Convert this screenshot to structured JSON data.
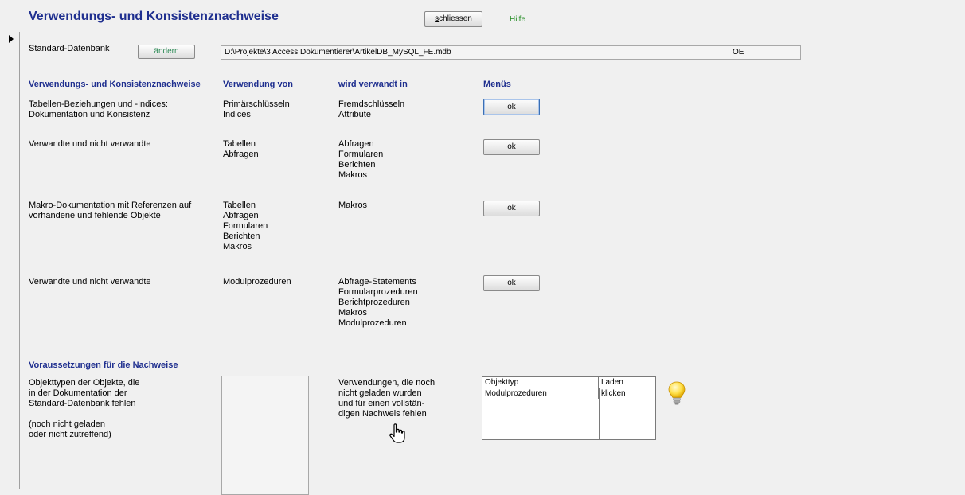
{
  "header": {
    "title": "Verwendungs- und Konsistenznachweise",
    "close_button": "schliessen",
    "close_accesskey": "s",
    "close_rest": "chliessen",
    "help": "Hilfe"
  },
  "database": {
    "label": "Standard-Datenbank",
    "change_button": "ändern",
    "path": "D:\\Projekte\\3 Access Dokumentierer\\ArtikelDB_MySQL_FE.mdb",
    "suffix": "OE"
  },
  "columns": {
    "c1": "Verwendungs- und Konsistenznachweise",
    "c2": "Verwendung von",
    "c3": "wird verwandt in",
    "c4": "Menüs"
  },
  "rows": [
    {
      "desc": [
        "Tabellen-Beziehungen und -Indices:",
        "Dokumentation und Konsistenz"
      ],
      "uses": [
        "Primärschlüsseln",
        "Indices"
      ],
      "used_in": [
        "Fremdschlüsseln",
        "Attribute"
      ],
      "button": "ok"
    },
    {
      "desc": [
        "Verwandte und nicht verwandte"
      ],
      "uses": [
        "Tabellen",
        "Abfragen"
      ],
      "used_in": [
        "Abfragen",
        "Formularen",
        "Berichten",
        "Makros"
      ],
      "button": "ok"
    },
    {
      "desc": [
        "Makro-Dokumentation mit Referenzen auf",
        "vorhandene und fehlende Objekte"
      ],
      "uses": [
        "Tabellen",
        "Abfragen",
        "Formularen",
        "Berichten",
        "Makros"
      ],
      "used_in": [
        "Makros"
      ],
      "button": "ok"
    },
    {
      "desc": [
        "Verwandte und nicht verwandte"
      ],
      "uses": [
        "Modulprozeduren"
      ],
      "used_in": [
        "Abfrage-Statements",
        "Formularprozeduren",
        "Berichtprozeduren",
        "Makros",
        "Modulprozeduren"
      ],
      "button": "ok"
    }
  ],
  "prereq": {
    "title": "Voraussetzungen für die Nachweise",
    "desc": [
      "Objekttypen der Objekte, die",
      "in der Dokumentation der",
      "Standard-Datenbank fehlen",
      "",
      "(noch nicht geladen",
      "oder nicht zutreffend)"
    ],
    "missing_text": [
      "Verwendungen, die noch",
      "nicht geladen wurden",
      "und für einen vollstän-",
      "digen Nachweis fehlen"
    ],
    "grid_headers": [
      "Objekttyp",
      "Laden"
    ],
    "grid_rows": [
      [
        "Modulprozeduren",
        "klicken"
      ]
    ]
  },
  "colors": {
    "heading": "#1f2f8f",
    "help": "#1f8a1f",
    "change_button_text": "#2e8b57"
  }
}
